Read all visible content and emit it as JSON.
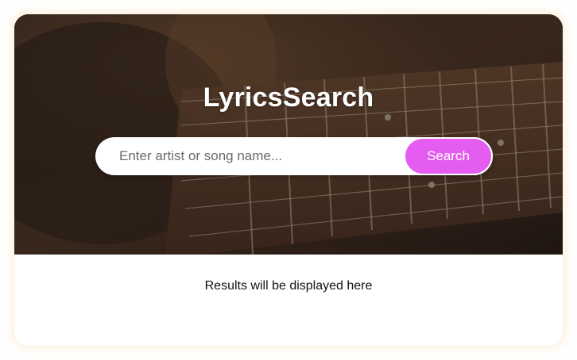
{
  "app": {
    "title": "LyricsSearch"
  },
  "search": {
    "placeholder": "Enter artist or song name...",
    "value": "",
    "button_label": "Search"
  },
  "results": {
    "message": "Results will be displayed here"
  },
  "colors": {
    "accent": "#e55cf0",
    "hero_overlay": "#2a1f18",
    "page_bg": "#ffffff",
    "title_text": "#ffffff"
  }
}
